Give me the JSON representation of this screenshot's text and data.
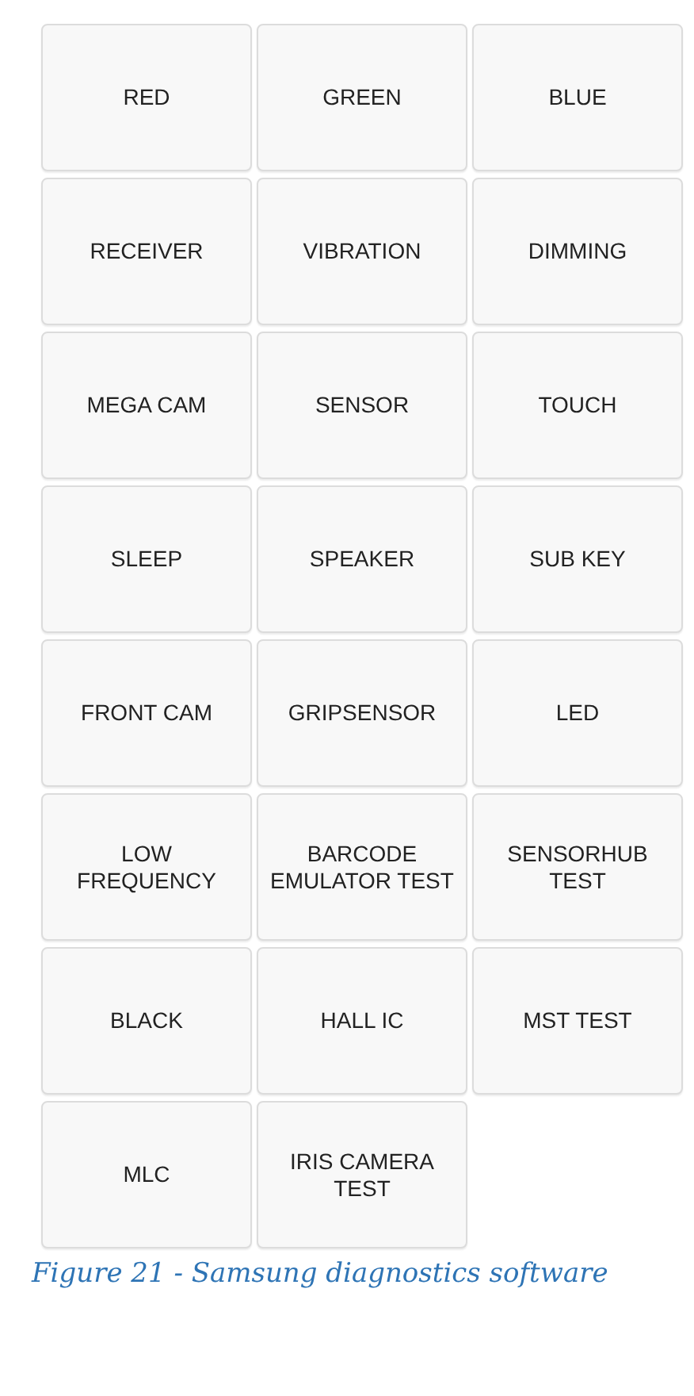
{
  "tests": [
    {
      "label": "RED"
    },
    {
      "label": "GREEN"
    },
    {
      "label": "BLUE"
    },
    {
      "label": "RECEIVER"
    },
    {
      "label": "VIBRATION"
    },
    {
      "label": "DIMMING"
    },
    {
      "label": "MEGA CAM"
    },
    {
      "label": "SENSOR"
    },
    {
      "label": "TOUCH"
    },
    {
      "label": "SLEEP"
    },
    {
      "label": "SPEAKER"
    },
    {
      "label": "SUB KEY"
    },
    {
      "label": "FRONT CAM"
    },
    {
      "label": "GRIPSENSOR"
    },
    {
      "label": "LED"
    },
    {
      "label": "LOW FREQUENCY"
    },
    {
      "label": "BARCODE\nEMULATOR TEST"
    },
    {
      "label": "SENSORHUB TEST"
    },
    {
      "label": "BLACK"
    },
    {
      "label": "HALL IC"
    },
    {
      "label": "MST TEST"
    },
    {
      "label": "MLC"
    },
    {
      "label": "IRIS CAMERA\nTEST"
    }
  ],
  "caption": "Figure 21 - Samsung diagnostics software"
}
